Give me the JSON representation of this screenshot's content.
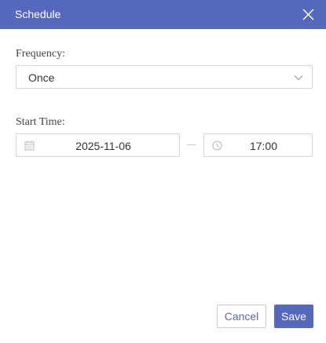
{
  "dialog": {
    "title": "Schedule",
    "header_color": "#5668bc"
  },
  "frequency": {
    "label": "Frequency:",
    "value": "Once"
  },
  "start_time": {
    "label": "Start Time:",
    "date": "2025-11-06",
    "time": "17:00"
  },
  "actions": {
    "cancel_label": "Cancel",
    "save_label": "Save"
  },
  "icons": {
    "close": "close-icon",
    "dropdown": "chevron-down-icon",
    "date": "calendar-icon",
    "time": "clock-icon"
  }
}
